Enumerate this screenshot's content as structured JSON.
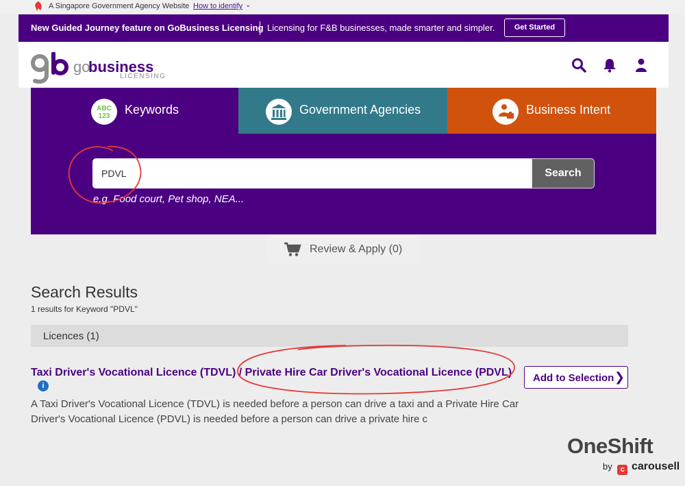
{
  "gov_banner": {
    "text": "A Singapore Government Agency Website",
    "link": "How to identify"
  },
  "promo": {
    "bold_text": "New Guided Journey feature on GoBusiness Licensing",
    "text": "Licensing for F&B businesses, made smarter and simpler.",
    "button": "Get Started"
  },
  "logo": {
    "prefix": "go",
    "name": "business",
    "sub": "LICENSING"
  },
  "header_icons": [
    "search-icon",
    "bell-icon",
    "user-icon"
  ],
  "tabs": [
    {
      "label": "Keywords",
      "icon_text_top": "ABC",
      "icon_text_bottom": "123",
      "color": "#4b0082"
    },
    {
      "label": "Government Agencies",
      "icon": "bank-building-icon",
      "color": "#327a8a"
    },
    {
      "label": "Business Intent",
      "icon": "briefcase-person-icon",
      "color": "#d0520c"
    }
  ],
  "search": {
    "value": "PDVL",
    "button": "Search",
    "hint": "e.g. Food court, Pet shop, NEA..."
  },
  "review": {
    "label": "Review & Apply (0)"
  },
  "results": {
    "title": "Search Results",
    "subtitle": "1 results for Keyword \"PDVL\"",
    "section": "Licences (1)",
    "items": [
      {
        "title": "Taxi Driver's Vocational Licence (TDVL) / Private Hire Car Driver's Vocational Licence (PDVL)",
        "info": "i",
        "button": "Add to Selection",
        "description": "A Taxi Driver's Vocational Licence (TDVL) is needed before a person can drive a taxi and a Private Hire Car Driver's Vocational Licence (PDVL) is needed before a person can drive a private hire c"
      }
    ]
  },
  "watermark": {
    "brand": "OneShift",
    "by": "by",
    "partner": "carousell",
    "partner_icon": "c"
  },
  "colors": {
    "brand_purple": "#4b0082",
    "tab_teal": "#327a8a",
    "tab_orange": "#d0520c",
    "annotation_red": "#e53935"
  }
}
